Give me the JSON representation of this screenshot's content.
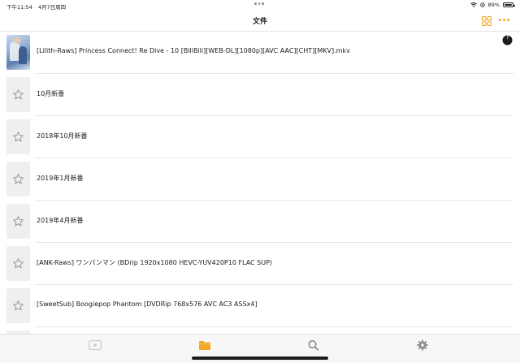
{
  "status_bar": {
    "time": "下午11:54",
    "date": "4月7日周四",
    "battery": "89%"
  },
  "nav": {
    "title": "文件",
    "accent_color": "#f5a623"
  },
  "files": [
    {
      "label": "[Lilith-Raws] Princess Connect! Re Dive - 10 [BiliBili][WEB-DL][1080p][AVC AAC][CHT][MKV].mkv",
      "thumbnail": "anime-thumbnail",
      "favorite": false,
      "progress_icon": "progress-icon"
    },
    {
      "label": "10月新番",
      "thumbnail": "star-icon",
      "favorite": false
    },
    {
      "label": "2018年10月新番",
      "thumbnail": "star-icon",
      "favorite": false
    },
    {
      "label": "2019年1月新番",
      "thumbnail": "star-icon",
      "favorite": false
    },
    {
      "label": "2019年4月新番",
      "thumbnail": "star-icon",
      "favorite": false
    },
    {
      "label": "[ANK-Raws] ワンパンマン (BDrip 1920x1080 HEVC-YUV420P10 FLAC SUP)",
      "thumbnail": "star-icon",
      "favorite": false
    },
    {
      "label": "[SweetSub] Boogiepop Phantom [DVDRip 768x576 AVC AC3 ASSx4]",
      "thumbnail": "star-icon",
      "favorite": false
    }
  ],
  "tab_bar": {
    "tabs": [
      {
        "name": "video",
        "icon": "play-video-icon",
        "active": false
      },
      {
        "name": "files",
        "icon": "folder-icon",
        "active": true
      },
      {
        "name": "search",
        "icon": "search-icon",
        "active": false
      },
      {
        "name": "settings",
        "icon": "gear-icon",
        "active": false
      }
    ],
    "active_color": "#f5a623",
    "inactive_color": "#8e8e93"
  }
}
